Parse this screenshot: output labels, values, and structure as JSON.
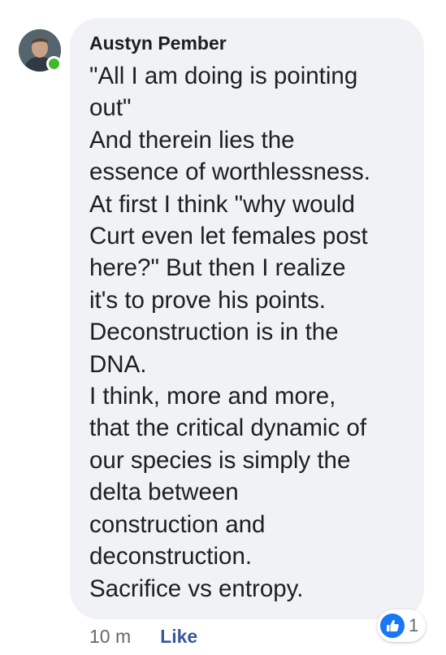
{
  "comment": {
    "author": "Austyn Pember",
    "lines": [
      "\"All I am doing is pointing",
      "out\"",
      "And therein lies the",
      "essence of worthlessness.",
      "At first I think \"why would",
      "Curt even let females post",
      "here?\" But then I realize",
      "it's to prove his points.",
      "Deconstruction is in the",
      "DNA.",
      "I think, more and more,",
      "that the critical dynamic of",
      "our species is simply the",
      "delta between",
      "construction and",
      "deconstruction.",
      "Sacrifice vs entropy."
    ],
    "timestamp": "10 m",
    "like_label": "Like",
    "reaction_count": "1",
    "reaction_icon": "thumbs-up-icon",
    "online": true
  },
  "colors": {
    "bubble": "#f0f2f5",
    "text": "#1c1e21",
    "muted": "#65676b",
    "link": "#385898",
    "like_blue": "#1877f2",
    "online_green": "#42b72a"
  }
}
